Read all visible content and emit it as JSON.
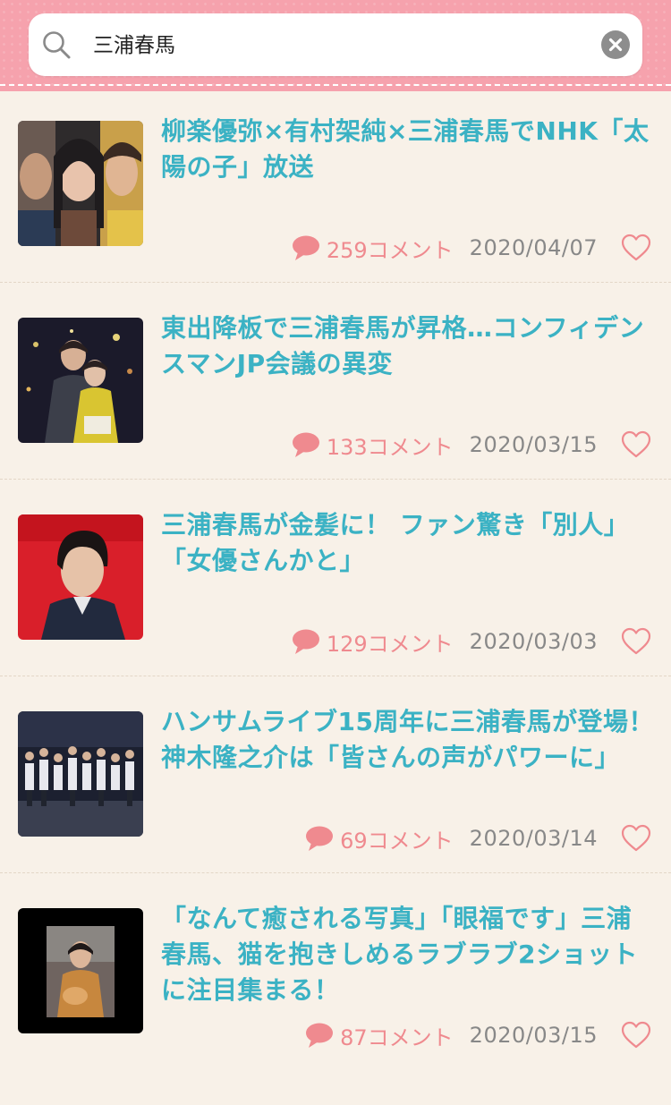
{
  "search": {
    "query": "三浦春馬"
  },
  "colors": {
    "header_pink": "#f6a2ad",
    "title_teal": "#3bb2c4",
    "comment_pink": "#ef8a8f",
    "background": "#f8f1e8"
  },
  "articles": [
    {
      "title": "柳楽優弥×有村架純×三浦春馬でNHK「太陽の子」放送",
      "comments": "259コメント",
      "date": "2020/04/07"
    },
    {
      "title": "東出降板で三浦春馬が昇格…コンフィデンスマンJP会議の異変",
      "comments": "133コメント",
      "date": "2020/03/15"
    },
    {
      "title": "三浦春馬が金髪に！ ファン驚き「別人」「女優さんかと」",
      "comments": "129コメント",
      "date": "2020/03/03"
    },
    {
      "title": "ハンサムライブ15周年に三浦春馬が登場！ 神木隆之介は「皆さんの声がパワーに」",
      "comments": "69コメント",
      "date": "2020/03/14"
    },
    {
      "title": "「なんて癒される写真」「眼福です」三浦春馬、猫を抱きしめるラブラブ2ショットに注目集まる！",
      "comments": "87コメント",
      "date": "2020/03/15"
    }
  ]
}
